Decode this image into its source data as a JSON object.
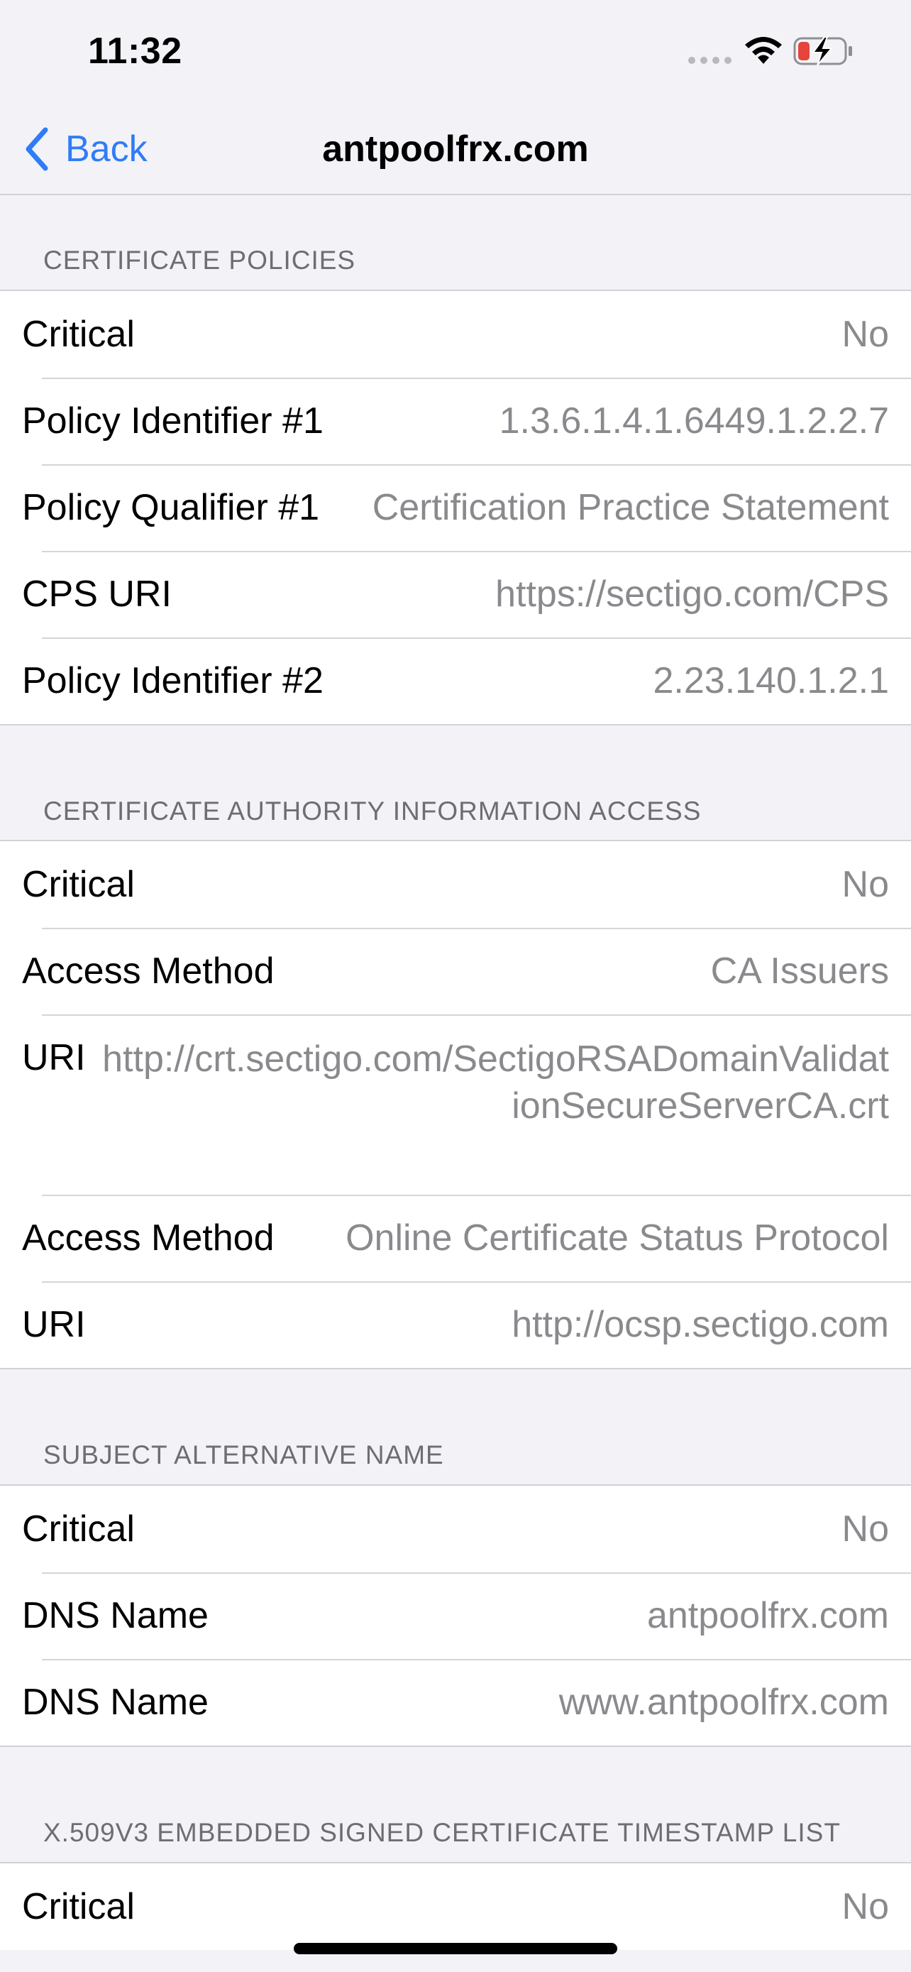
{
  "status_bar": {
    "time": "11:32",
    "icons": [
      "cellular-signal-icon",
      "wifi-icon",
      "battery-charging-icon"
    ],
    "battery_color": "#e5453a"
  },
  "nav": {
    "back_label": "Back",
    "title": "antpoolfrx.com",
    "accent_color": "#2f7cf6"
  },
  "sections": [
    {
      "header": "CERTIFICATE POLICIES",
      "rows": [
        {
          "label": "Critical",
          "value": "No"
        },
        {
          "label": "Policy Identifier #1",
          "value": "1.3.6.1.4.1.6449.1.2.2.7"
        },
        {
          "label": "Policy Qualifier #1",
          "value": "Certification Practice Statement"
        },
        {
          "label": "CPS URI",
          "value": "https://sectigo.com/CPS"
        },
        {
          "label": "Policy Identifier #2",
          "value": "2.23.140.1.2.1"
        }
      ]
    },
    {
      "header": "CERTIFICATE AUTHORITY INFORMATION ACCESS",
      "rows": [
        {
          "label": "Critical",
          "value": "No"
        },
        {
          "label": "Access Method",
          "value": "CA Issuers"
        },
        {
          "label": "URI",
          "value": "http://crt.sectigo.com/SectigoRSADomainValidationSecureServerCA.crt"
        },
        {
          "label": "Access Method",
          "value": "Online Certificate Status Protocol"
        },
        {
          "label": "URI",
          "value": "http://ocsp.sectigo.com"
        }
      ]
    },
    {
      "header": "SUBJECT ALTERNATIVE NAME",
      "rows": [
        {
          "label": "Critical",
          "value": "No"
        },
        {
          "label": "DNS Name",
          "value": "antpoolfrx.com"
        },
        {
          "label": "DNS Name",
          "value": "www.antpoolfrx.com"
        }
      ]
    },
    {
      "header": "X.509V3 EMBEDDED SIGNED CERTIFICATE TIMESTAMP LIST",
      "rows": [
        {
          "label": "Critical",
          "value": "No"
        }
      ]
    }
  ]
}
